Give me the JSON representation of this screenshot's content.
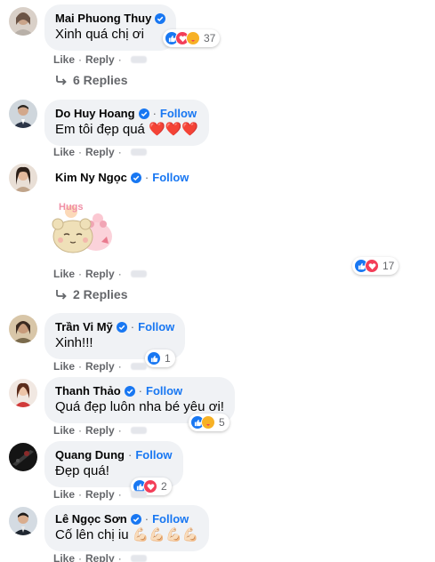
{
  "comments": [
    {
      "author": "Mai Phuong Thuy",
      "follow": "",
      "text": "Xinh quá chị ơi",
      "reactions_count": "37",
      "replies": "6 Replies"
    },
    {
      "author": "Do Huy Hoang",
      "follow": "Follow",
      "text": "Em tôi đẹp quá ❤️❤️❤️"
    },
    {
      "author": "Kim Ny Ngọc",
      "follow": "Follow",
      "sticker_label": "Hugs",
      "reactions_count": "17",
      "replies": "2 Replies"
    },
    {
      "author": "Trần Vi Mỹ",
      "follow": "Follow",
      "text": "Xinh!!!",
      "reactions_count": "1"
    },
    {
      "author": "Thanh Thảo",
      "follow": "Follow",
      "text": "Quá đẹp luôn nha bé yêu ơi!",
      "reactions_count": "5"
    },
    {
      "author": "Quang Dung",
      "follow": "Follow",
      "text": "Đẹp quá!",
      "reactions_count": "2"
    },
    {
      "author": "Lê Ngọc Sơn",
      "follow": "Follow",
      "text": "Cố lên chị iu 💪🏻💪🏻💪🏻💪🏻"
    }
  ],
  "actions": {
    "like": "Like",
    "reply": "Reply",
    "separator": "·",
    "follow_separator": "·"
  },
  "colors": {
    "accent": "#1877f2",
    "bubble": "#f0f2f5",
    "muted": "#65676b",
    "love": "#f33e58",
    "care": "#f7b125"
  },
  "icons": {
    "verified": "verified-badge-icon",
    "reply_arrow": "reply-arrow-icon",
    "like": "like-reaction-icon",
    "love": "love-reaction-icon",
    "care": "care-reaction-icon"
  }
}
